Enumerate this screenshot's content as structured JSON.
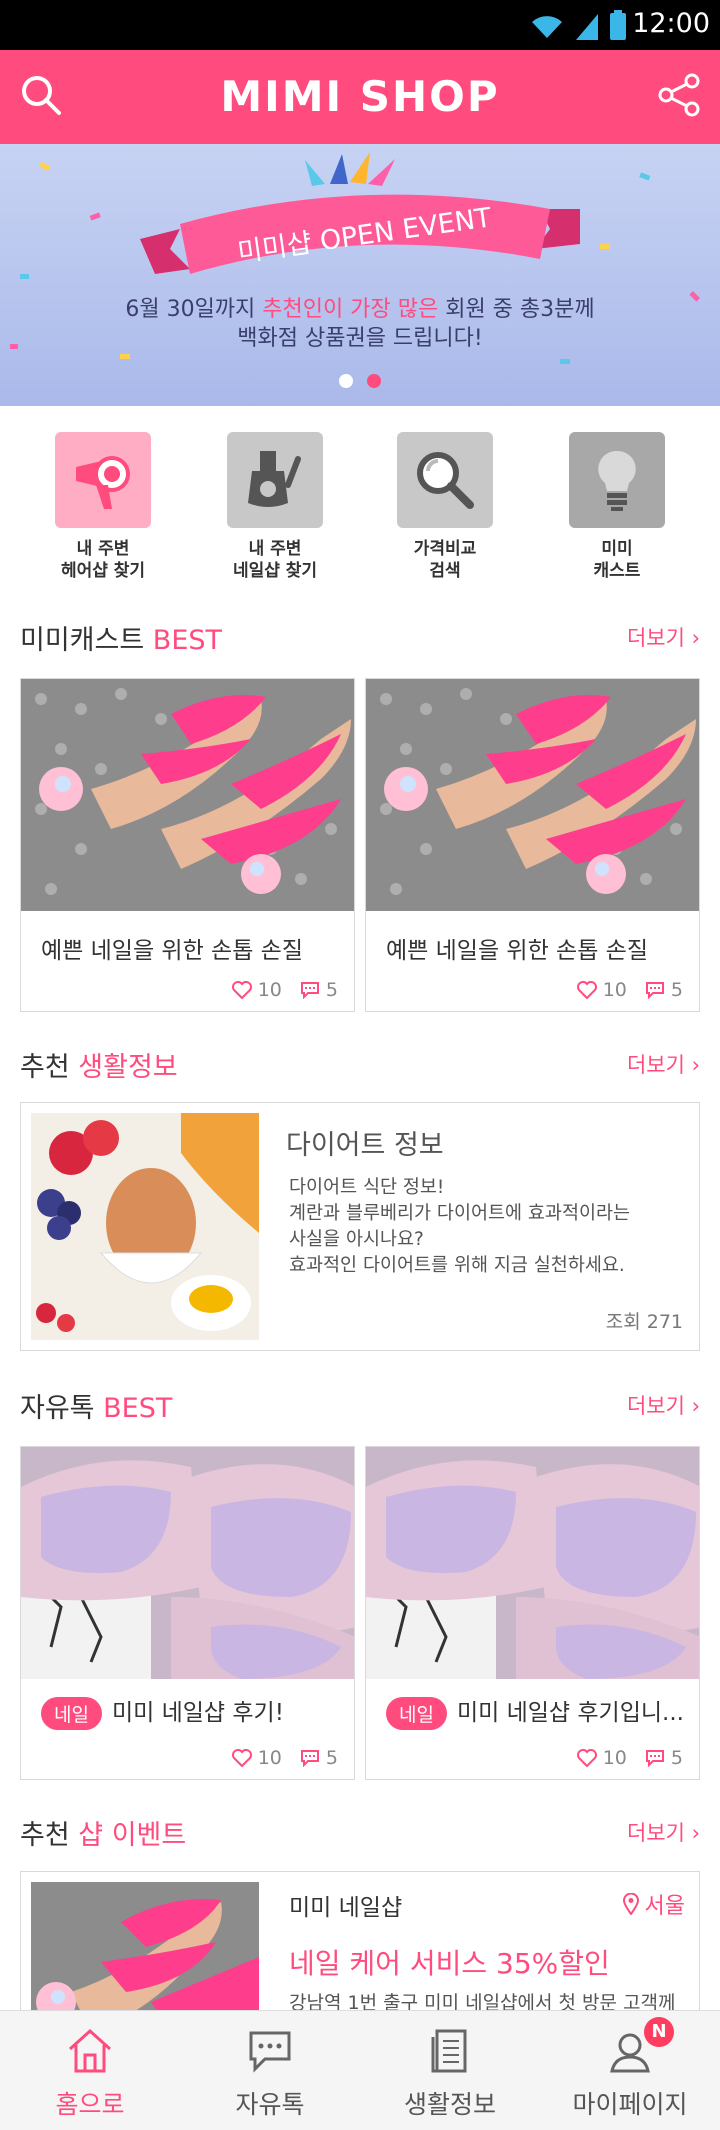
{
  "status": {
    "time": "12:00"
  },
  "header": {
    "title": "MIMI SHOP"
  },
  "banner": {
    "ribbon_text": "미미샵 OPEN EVENT",
    "line1_pre": "6월 30일까지 ",
    "line1_highlight": "추천인이 가장 많은",
    "line1_post": " 회원 중 총3분께",
    "line2": "백화점 상품권을 드립니다!",
    "slide_count": 2,
    "active_slide": 2
  },
  "quick_menu": [
    {
      "line1": "내 주변",
      "line2": "헤어샵 찾기",
      "icon": "hair-dryer-icon"
    },
    {
      "line1": "내 주변",
      "line2": "네일샵 찾기",
      "icon": "nail-polish-icon"
    },
    {
      "line1": "가격비교",
      "line2": "검색",
      "icon": "magnifier-icon"
    },
    {
      "line1": "미미",
      "line2": "캐스트",
      "icon": "lightbulb-icon"
    }
  ],
  "mimicast": {
    "title_plain": "미미캐스트 ",
    "title_accent": "BEST",
    "more": "더보기",
    "cards": [
      {
        "title": "예쁜 네일을 위한 손톱 손질",
        "likes": "10",
        "comments": "5"
      },
      {
        "title": "예쁜 네일을 위한 손톱 손질",
        "likes": "10",
        "comments": "5"
      }
    ]
  },
  "lifeinfo": {
    "title_plain": "추천 ",
    "title_accent": "생활정보",
    "more": "더보기",
    "item": {
      "heading": "다이어트 정보",
      "lines": [
        "다이어트 식단 정보!",
        "계란과 블루베리가 다이어트에 효과적이라는",
        "사실을 아시나요?",
        "효과적인 다이어트를 위해 지금 실천하세요."
      ],
      "views": "조회 271"
    }
  },
  "freetalk": {
    "title_plain": "자유톡 ",
    "title_accent": "BEST",
    "more": "더보기",
    "cards": [
      {
        "tag": "네일",
        "title": "미미 네일샵 후기!",
        "likes": "10",
        "comments": "5"
      },
      {
        "tag": "네일",
        "title": "미미 네일샵 후기입니...",
        "likes": "10",
        "comments": "5"
      }
    ]
  },
  "shopevent": {
    "title_plain": "추천 ",
    "title_accent": "샵 이벤트",
    "more": "더보기",
    "item": {
      "name": "미미 네일샵",
      "location": "서울",
      "promo": "네일 케어 서비스 35%할인",
      "desc": "강남역 1번 출구 미미 네일샵에서 첫 방문 고객께"
    }
  },
  "bottom_nav": [
    {
      "label": "홈으로",
      "icon": "home-icon",
      "active": true
    },
    {
      "label": "자유톡",
      "icon": "chat-icon",
      "active": false
    },
    {
      "label": "생활정보",
      "icon": "document-icon",
      "active": false
    },
    {
      "label": "마이페이지",
      "icon": "profile-icon",
      "active": false,
      "badge": "N"
    }
  ],
  "colors": {
    "accent": "#ff4b7d",
    "status_bar": "#000000"
  }
}
